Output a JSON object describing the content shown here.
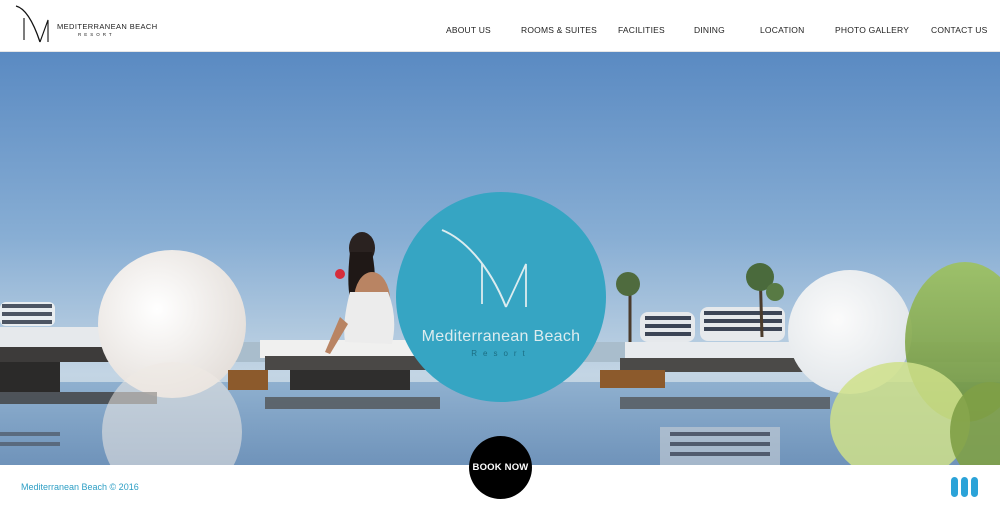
{
  "header": {
    "logo": {
      "name": "MEDITERRANEAN BEACH",
      "sub": "RESORT"
    },
    "nav": [
      {
        "label": "ABOUT US"
      },
      {
        "label": "ROOMS & SUITES"
      },
      {
        "label": "FACILITIES"
      },
      {
        "label": "DINING"
      },
      {
        "label": "LOCATION"
      },
      {
        "label": "PHOTO GALLERY"
      },
      {
        "label": "CONTACT US"
      }
    ]
  },
  "hero": {
    "logo_name": "Mediterranean Beach",
    "logo_sub": "Resort"
  },
  "book_now": {
    "label": "BOOK NOW"
  },
  "footer": {
    "copyright": "Mediterranean Beach © 2016"
  },
  "colors": {
    "accent": "#36a5c3",
    "copyright": "#2e9fc5",
    "menu": "#2ba3d8"
  },
  "icons": {
    "logo": "logo-mark-icon",
    "menu": "menu-bars-icon"
  }
}
